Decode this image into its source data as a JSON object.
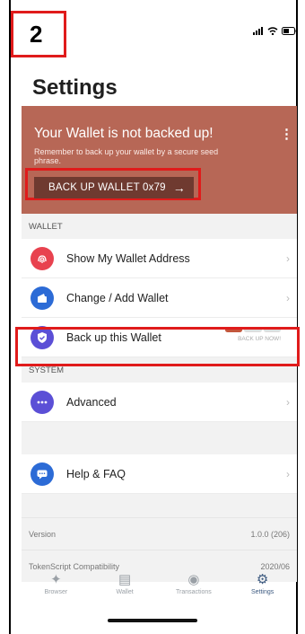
{
  "step_label": "2",
  "page_title": "Settings",
  "backup_banner": {
    "title": "Your Wallet is not backed up!",
    "subtitle": "Remember to back up your wallet by a secure seed phrase.",
    "button_label": "BACK UP WALLET 0x79",
    "menu_icon": "kebab-icon"
  },
  "sections": {
    "wallet": {
      "header": "WALLET",
      "items": [
        {
          "label": "Show My Wallet Address",
          "icon": "fingerprint-icon",
          "color": "#e8424f"
        },
        {
          "label": "Change / Add Wallet",
          "icon": "wallet-icon",
          "color": "#2c6bd6"
        },
        {
          "label": "Back up this Wallet",
          "icon": "shield-icon",
          "color": "#5b4fd6",
          "progress_label": "BACK UP NOW!",
          "progress_segments_filled": 1,
          "progress_segments_total": 3
        }
      ]
    },
    "system": {
      "header": "SYSTEM",
      "items": [
        {
          "label": "Advanced",
          "icon": "more-icon",
          "color": "#5b4fd6"
        },
        {
          "label": "Help & FAQ",
          "icon": "chat-icon",
          "color": "#2c6bd6"
        }
      ]
    }
  },
  "info": {
    "version_label": "Version",
    "version_value": "1.0.0 (206)",
    "tokenscript_label": "TokenScript Compatibility",
    "tokenscript_value": "2020/06"
  },
  "tabs": [
    {
      "label": "Browser",
      "icon": "browser-icon",
      "active": false
    },
    {
      "label": "Wallet",
      "icon": "wallet-tab-icon",
      "active": false
    },
    {
      "label": "Transactions",
      "icon": "transactions-icon",
      "active": false
    },
    {
      "label": "Settings",
      "icon": "gear-icon",
      "active": true
    }
  ],
  "colors": {
    "banner_bg": "#b76756",
    "banner_button_bg": "#6f3a30",
    "highlight": "#e01b1b",
    "active_tab": "#3d5a80"
  }
}
